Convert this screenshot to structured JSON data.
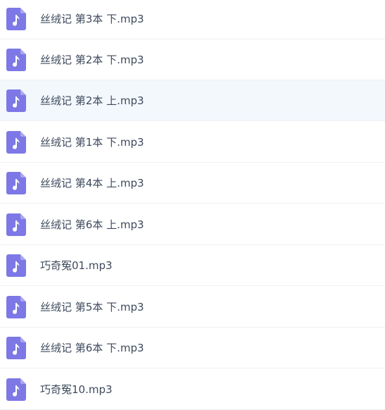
{
  "icon_color": "#7d78e6",
  "selected_row_color": "#f3f8fd",
  "files": [
    {
      "name": "丝绒记 第3本 下.mp3",
      "icon": "music-file-icon",
      "selected": false
    },
    {
      "name": "丝绒记 第2本 下.mp3",
      "icon": "music-file-icon",
      "selected": false
    },
    {
      "name": "丝绒记 第2本 上.mp3",
      "icon": "music-file-icon",
      "selected": true
    },
    {
      "name": "丝绒记 第1本 下.mp3",
      "icon": "music-file-icon",
      "selected": false
    },
    {
      "name": "丝绒记 第4本 上.mp3",
      "icon": "music-file-icon",
      "selected": false
    },
    {
      "name": "丝绒记 第6本 上.mp3",
      "icon": "music-file-icon",
      "selected": false
    },
    {
      "name": "巧奇冤01.mp3",
      "icon": "music-file-icon",
      "selected": false
    },
    {
      "name": "丝绒记 第5本 下.mp3",
      "icon": "music-file-icon",
      "selected": false
    },
    {
      "name": "丝绒记 第6本 下.mp3",
      "icon": "music-file-icon",
      "selected": false
    },
    {
      "name": "巧奇冤10.mp3",
      "icon": "music-file-icon",
      "selected": false
    }
  ]
}
